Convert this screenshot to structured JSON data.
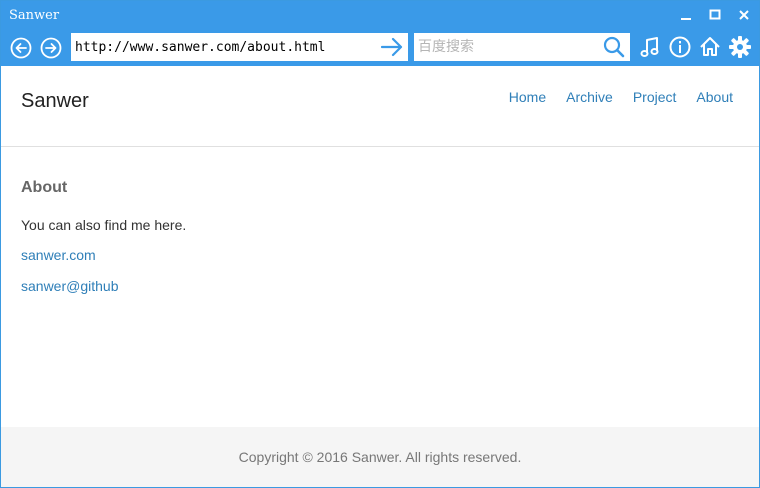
{
  "window": {
    "title": "Sanwer",
    "accent_color": "#3a9ae8",
    "controls": [
      "minimize-icon",
      "maximize-icon",
      "close-icon"
    ]
  },
  "toolbar": {
    "back_icon": "back-circle-icon",
    "forward_icon": "forward-circle-icon",
    "url": "http://www.sanwer.com/about.html",
    "go_icon": "arrow-right-icon",
    "search_placeholder": "百度搜索",
    "search_icon": "search-icon",
    "tools": [
      "music-icon",
      "info-icon",
      "home-icon",
      "gear-icon"
    ]
  },
  "site": {
    "title": "Sanwer",
    "nav": [
      "Home",
      "Archive",
      "Project",
      "About"
    ],
    "link_color": "#2f7fb8"
  },
  "main": {
    "heading": "About",
    "intro": "You can also find me here.",
    "links": [
      "sanwer.com",
      "sanwer@github"
    ]
  },
  "footer": {
    "copyright": "Copyright © 2016 Sanwer. All rights reserved."
  }
}
